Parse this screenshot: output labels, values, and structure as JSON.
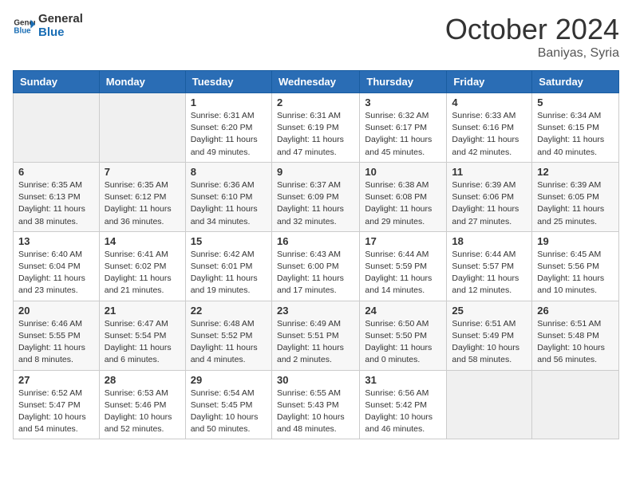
{
  "logo": {
    "line1": "General",
    "line2": "Blue"
  },
  "title": "October 2024",
  "location": "Baniyas, Syria",
  "days_of_week": [
    "Sunday",
    "Monday",
    "Tuesday",
    "Wednesday",
    "Thursday",
    "Friday",
    "Saturday"
  ],
  "weeks": [
    [
      {
        "day": "",
        "info": ""
      },
      {
        "day": "",
        "info": ""
      },
      {
        "day": "1",
        "info": "Sunrise: 6:31 AM\nSunset: 6:20 PM\nDaylight: 11 hours and 49 minutes."
      },
      {
        "day": "2",
        "info": "Sunrise: 6:31 AM\nSunset: 6:19 PM\nDaylight: 11 hours and 47 minutes."
      },
      {
        "day": "3",
        "info": "Sunrise: 6:32 AM\nSunset: 6:17 PM\nDaylight: 11 hours and 45 minutes."
      },
      {
        "day": "4",
        "info": "Sunrise: 6:33 AM\nSunset: 6:16 PM\nDaylight: 11 hours and 42 minutes."
      },
      {
        "day": "5",
        "info": "Sunrise: 6:34 AM\nSunset: 6:15 PM\nDaylight: 11 hours and 40 minutes."
      }
    ],
    [
      {
        "day": "6",
        "info": "Sunrise: 6:35 AM\nSunset: 6:13 PM\nDaylight: 11 hours and 38 minutes."
      },
      {
        "day": "7",
        "info": "Sunrise: 6:35 AM\nSunset: 6:12 PM\nDaylight: 11 hours and 36 minutes."
      },
      {
        "day": "8",
        "info": "Sunrise: 6:36 AM\nSunset: 6:10 PM\nDaylight: 11 hours and 34 minutes."
      },
      {
        "day": "9",
        "info": "Sunrise: 6:37 AM\nSunset: 6:09 PM\nDaylight: 11 hours and 32 minutes."
      },
      {
        "day": "10",
        "info": "Sunrise: 6:38 AM\nSunset: 6:08 PM\nDaylight: 11 hours and 29 minutes."
      },
      {
        "day": "11",
        "info": "Sunrise: 6:39 AM\nSunset: 6:06 PM\nDaylight: 11 hours and 27 minutes."
      },
      {
        "day": "12",
        "info": "Sunrise: 6:39 AM\nSunset: 6:05 PM\nDaylight: 11 hours and 25 minutes."
      }
    ],
    [
      {
        "day": "13",
        "info": "Sunrise: 6:40 AM\nSunset: 6:04 PM\nDaylight: 11 hours and 23 minutes."
      },
      {
        "day": "14",
        "info": "Sunrise: 6:41 AM\nSunset: 6:02 PM\nDaylight: 11 hours and 21 minutes."
      },
      {
        "day": "15",
        "info": "Sunrise: 6:42 AM\nSunset: 6:01 PM\nDaylight: 11 hours and 19 minutes."
      },
      {
        "day": "16",
        "info": "Sunrise: 6:43 AM\nSunset: 6:00 PM\nDaylight: 11 hours and 17 minutes."
      },
      {
        "day": "17",
        "info": "Sunrise: 6:44 AM\nSunset: 5:59 PM\nDaylight: 11 hours and 14 minutes."
      },
      {
        "day": "18",
        "info": "Sunrise: 6:44 AM\nSunset: 5:57 PM\nDaylight: 11 hours and 12 minutes."
      },
      {
        "day": "19",
        "info": "Sunrise: 6:45 AM\nSunset: 5:56 PM\nDaylight: 11 hours and 10 minutes."
      }
    ],
    [
      {
        "day": "20",
        "info": "Sunrise: 6:46 AM\nSunset: 5:55 PM\nDaylight: 11 hours and 8 minutes."
      },
      {
        "day": "21",
        "info": "Sunrise: 6:47 AM\nSunset: 5:54 PM\nDaylight: 11 hours and 6 minutes."
      },
      {
        "day": "22",
        "info": "Sunrise: 6:48 AM\nSunset: 5:52 PM\nDaylight: 11 hours and 4 minutes."
      },
      {
        "day": "23",
        "info": "Sunrise: 6:49 AM\nSunset: 5:51 PM\nDaylight: 11 hours and 2 minutes."
      },
      {
        "day": "24",
        "info": "Sunrise: 6:50 AM\nSunset: 5:50 PM\nDaylight: 11 hours and 0 minutes."
      },
      {
        "day": "25",
        "info": "Sunrise: 6:51 AM\nSunset: 5:49 PM\nDaylight: 10 hours and 58 minutes."
      },
      {
        "day": "26",
        "info": "Sunrise: 6:51 AM\nSunset: 5:48 PM\nDaylight: 10 hours and 56 minutes."
      }
    ],
    [
      {
        "day": "27",
        "info": "Sunrise: 6:52 AM\nSunset: 5:47 PM\nDaylight: 10 hours and 54 minutes."
      },
      {
        "day": "28",
        "info": "Sunrise: 6:53 AM\nSunset: 5:46 PM\nDaylight: 10 hours and 52 minutes."
      },
      {
        "day": "29",
        "info": "Sunrise: 6:54 AM\nSunset: 5:45 PM\nDaylight: 10 hours and 50 minutes."
      },
      {
        "day": "30",
        "info": "Sunrise: 6:55 AM\nSunset: 5:43 PM\nDaylight: 10 hours and 48 minutes."
      },
      {
        "day": "31",
        "info": "Sunrise: 6:56 AM\nSunset: 5:42 PM\nDaylight: 10 hours and 46 minutes."
      },
      {
        "day": "",
        "info": ""
      },
      {
        "day": "",
        "info": ""
      }
    ]
  ]
}
